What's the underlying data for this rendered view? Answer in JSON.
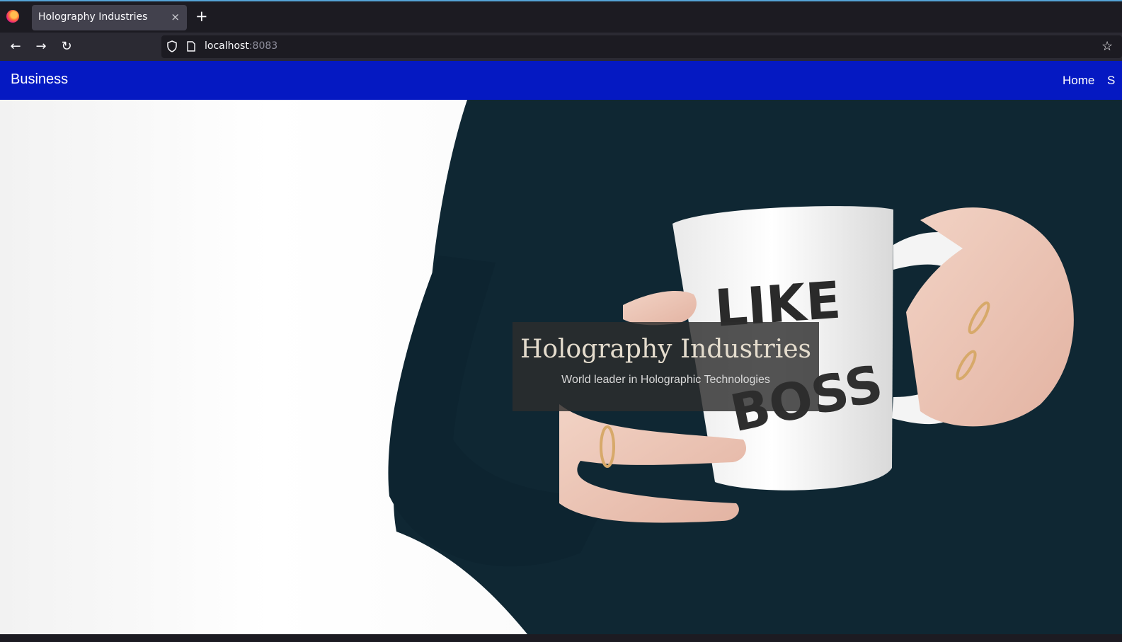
{
  "browser": {
    "tab_title": "Holography Industries",
    "tab_close": "×",
    "new_tab": "+",
    "url_host": "localhost",
    "url_port": ":8083",
    "back": "←",
    "forward": "→",
    "reload": "↻",
    "bookmark": "☆"
  },
  "site": {
    "brand": "Business",
    "nav_links": [
      "Home",
      "S"
    ],
    "hero": {
      "title": "Holography Industries",
      "subtitle": "World leader in Holographic Technologies"
    }
  },
  "colors": {
    "nav_bg": "#0519c2",
    "browser_bg": "#1c1b22"
  }
}
